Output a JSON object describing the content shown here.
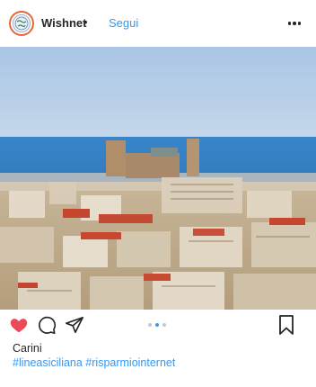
{
  "post": {
    "username": "Wishnet",
    "separator": "•",
    "follow_label": "Segui",
    "more_icon": "more-horizontal-icon",
    "avatar_icon": "globe-icon"
  },
  "photo": {
    "subject": "city-view-icon",
    "carousel": {
      "total": 3,
      "active_index": 1
    }
  },
  "actions": {
    "like_icon": "heart-icon",
    "liked": true,
    "comment_icon": "comment-icon",
    "share_icon": "share-icon",
    "save_icon": "bookmark-icon"
  },
  "caption": {
    "title": "Carini",
    "hashtags": "#lineasiciliana #risparmiointernet"
  },
  "colors": {
    "accent": "#3897f0",
    "like": "#ed4956",
    "text": "#262626"
  }
}
